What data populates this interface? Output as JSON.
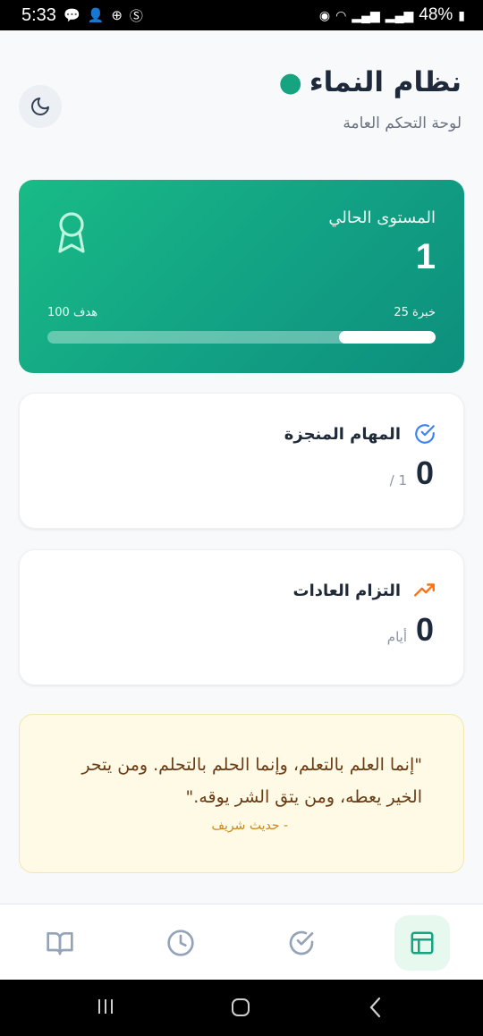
{
  "status_bar": {
    "time": "5:33",
    "battery": "48%"
  },
  "header": {
    "title": "نظام النماء",
    "subtitle": "لوحة التحكم العامة"
  },
  "level_card": {
    "label": "المستوى الحالي",
    "value": "1",
    "xp_text": "خبرة 25",
    "goal_text": "هدف 100",
    "progress_fraction": 0.25
  },
  "tasks_card": {
    "title": "المهام المنجزة",
    "value": "0",
    "unit": "/ 1"
  },
  "habits_card": {
    "title": "التزام العادات",
    "value": "0",
    "unit": "أيام"
  },
  "quote": {
    "text": "\"إنما العلم بالتعلم، وإنما الحلم بالتحلم. ومن يتحر الخير يعطه، ومن يتق الشر يوقه.\"",
    "source": "- حديث شريف"
  },
  "nav": [
    {
      "name": "book-icon",
      "active": false
    },
    {
      "name": "clock-icon",
      "active": false
    },
    {
      "name": "check-circle-icon",
      "active": false
    },
    {
      "name": "layout-icon",
      "active": true
    }
  ],
  "colors": {
    "accent": "#16a37f",
    "warning": "#f97316",
    "info": "#3b82f6"
  }
}
